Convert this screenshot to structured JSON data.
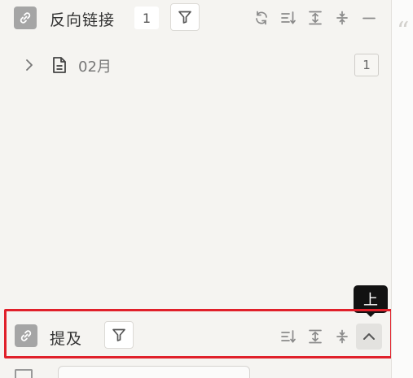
{
  "backlinks": {
    "title": "反向链接",
    "count": "1",
    "items": [
      {
        "label": "02月",
        "count": "1"
      }
    ]
  },
  "mentions": {
    "title": "提及"
  },
  "tooltip": {
    "text": "上"
  },
  "quote_glyph": "“",
  "colors": {
    "highlight": "#e0202a",
    "tooltip_bg": "#121212",
    "panel_bg": "#f5f4f1"
  },
  "icons": [
    "link-icon",
    "filter-icon",
    "refresh-icon",
    "sort-icon",
    "expand-icon",
    "collapse-icon",
    "minimize-icon",
    "chevron-right-icon",
    "document-icon",
    "chevron-up-icon"
  ]
}
